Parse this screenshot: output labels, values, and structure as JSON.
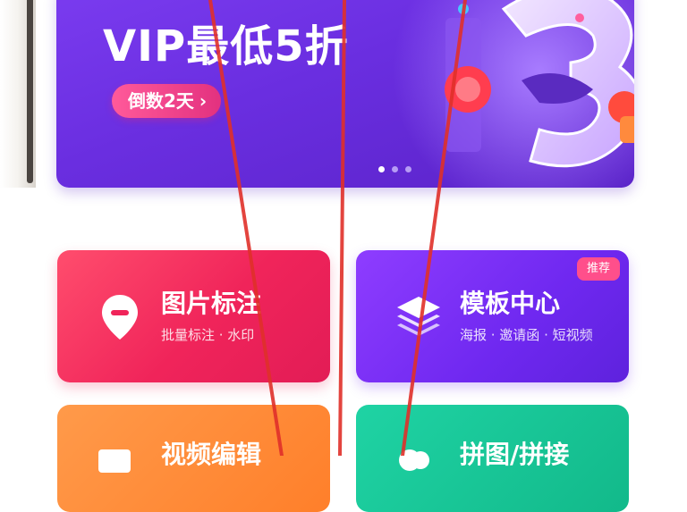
{
  "banner": {
    "title": "VIP最低5折",
    "countdown_label": "倒数2天",
    "countdown_chevron": "›",
    "illustration_icon": "number-three-illustration-icon",
    "carousel": {
      "pages": 3,
      "active_index": 0
    }
  },
  "cards": [
    {
      "title": "图片标注",
      "subtitle": "批量标注 · 水印",
      "icon": "map-pin-icon",
      "color": "#f0245a"
    },
    {
      "title": "模板中心",
      "subtitle": "海报 · 邀请函 · 短视频",
      "icon": "layers-icon",
      "color": "#6f28f0",
      "badge": "推荐"
    },
    {
      "title": "视频编辑",
      "subtitle": "",
      "icon": "video-icon",
      "color": "#ff7f2a"
    },
    {
      "title": "拼图/拼接",
      "subtitle": "",
      "icon": "cloud-icon",
      "color": "#12b98a"
    }
  ],
  "annotation_color": "#e0302a"
}
